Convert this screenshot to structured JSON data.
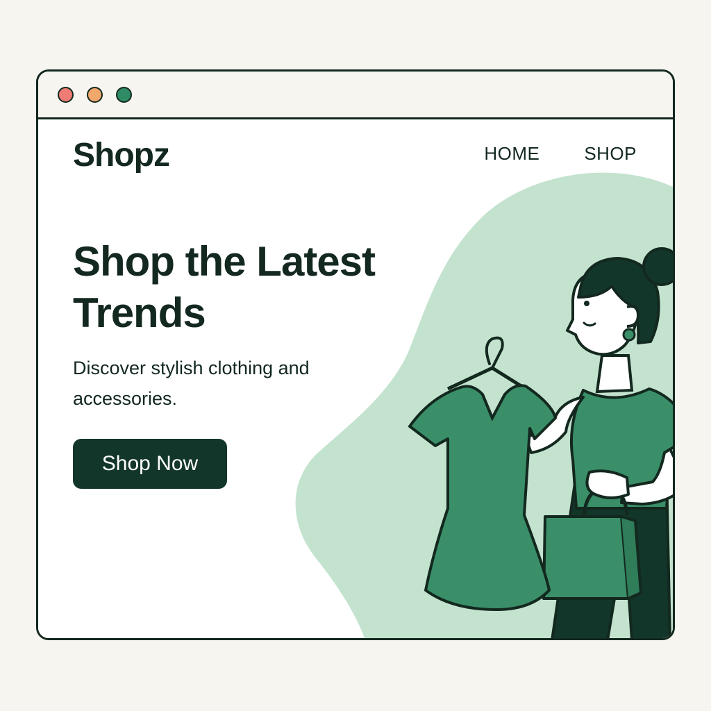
{
  "window": {
    "controls": [
      {
        "name": "close",
        "color": "#ee7b74"
      },
      {
        "name": "minimize",
        "color": "#f2a76b"
      },
      {
        "name": "maximize",
        "color": "#2f8b63"
      }
    ]
  },
  "header": {
    "logo": "Shopz",
    "nav": [
      {
        "label": "HOME"
      },
      {
        "label": "SHOP"
      }
    ]
  },
  "hero": {
    "title": "Shop the Latest Trends",
    "subtitle": "Discover stylish clothing and accessories.",
    "cta_label": "Shop Now"
  },
  "colors": {
    "primary_dark": "#13362a",
    "accent_green": "#3a8f68",
    "blob_green": "#c4e3cf",
    "text": "#13281f",
    "frame_bg": "#f6f5f0"
  },
  "illustration": {
    "subject": "woman holding dress on hanger and shopping bag",
    "icons": [
      "hanger-icon",
      "dress-icon",
      "shopping-bag-icon"
    ]
  }
}
